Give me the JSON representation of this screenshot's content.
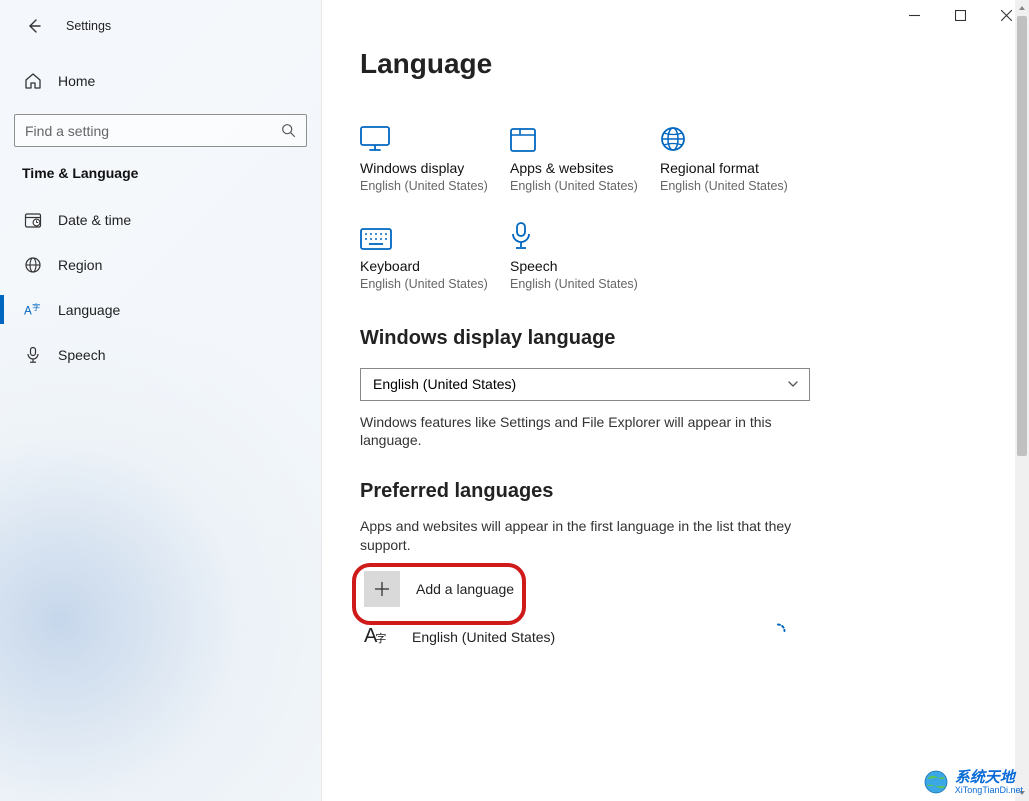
{
  "app": {
    "title": "Settings"
  },
  "sidebar": {
    "home": "Home",
    "search_placeholder": "Find a setting",
    "section": "Time & Language",
    "items": [
      {
        "key": "date-time",
        "label": "Date & time"
      },
      {
        "key": "region",
        "label": "Region"
      },
      {
        "key": "language",
        "label": "Language"
      },
      {
        "key": "speech",
        "label": "Speech"
      }
    ]
  },
  "page": {
    "title": "Language",
    "tiles": [
      {
        "key": "windows-display",
        "title": "Windows display",
        "sub": "English (United States)"
      },
      {
        "key": "apps-websites",
        "title": "Apps & websites",
        "sub": "English (United States)"
      },
      {
        "key": "regional-format",
        "title": "Regional format",
        "sub": "English (United States)"
      },
      {
        "key": "keyboard",
        "title": "Keyboard",
        "sub": "English (United States)"
      },
      {
        "key": "speech-tile",
        "title": "Speech",
        "sub": "English (United States)"
      }
    ],
    "display_lang_heading": "Windows display language",
    "display_lang_selected": "English (United States)",
    "display_lang_help": "Windows features like Settings and File Explorer will appear in this language.",
    "preferred_heading": "Preferred languages",
    "preferred_help": "Apps and websites will appear in the first language in the list that they support.",
    "add_language": "Add a language",
    "installed_language": "English (United States)"
  },
  "watermark": {
    "line1": "系统天地",
    "line2": "XiTongTianDi.net"
  }
}
